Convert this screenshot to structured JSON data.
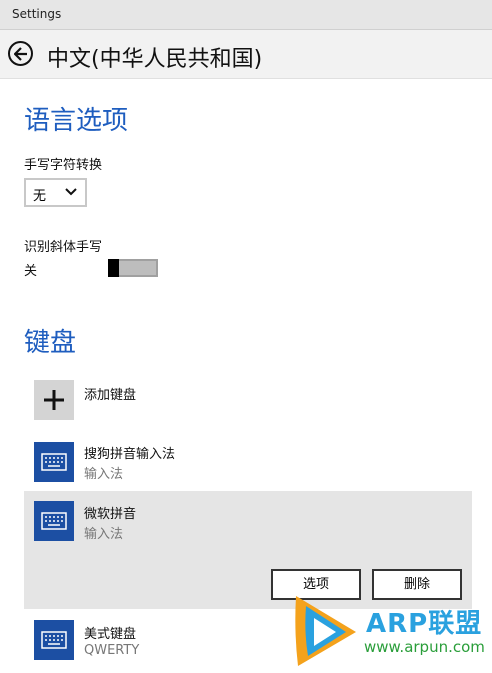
{
  "window": {
    "title": "Settings"
  },
  "header": {
    "title": "中文(中华人民共和国)"
  },
  "language_options": {
    "heading": "语言选项",
    "handwriting_conversion": {
      "label": "手写字符转换",
      "value": "无"
    },
    "italic_recognition": {
      "label": "识别斜体手写",
      "state_label": "关",
      "on": false
    }
  },
  "keyboard": {
    "heading": "键盘",
    "add_label": "添加键盘",
    "items": [
      {
        "name": "搜狗拼音输入法",
        "sub": "输入法"
      },
      {
        "name": "微软拼音",
        "sub": "输入法",
        "selected": true
      },
      {
        "name": "美式键盘",
        "sub": "QWERTY"
      }
    ],
    "options_button": "选项",
    "delete_button": "删除"
  },
  "watermark": {
    "brand": "ARP联盟",
    "url": "www.arpun.com"
  },
  "colors": {
    "accent": "#1e5dbf",
    "tile": "#1c4fa3",
    "selected": "#e5e5e5"
  }
}
